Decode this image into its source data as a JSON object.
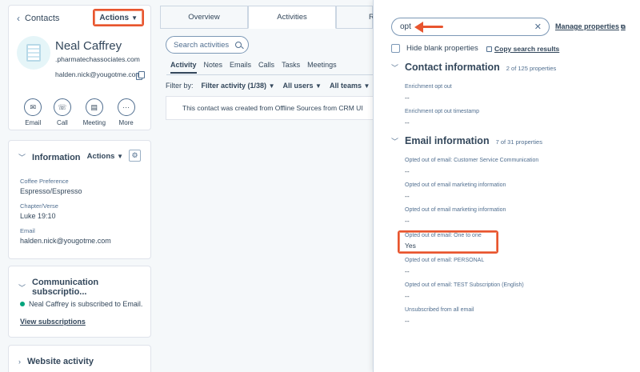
{
  "left": {
    "back_label": "Contacts",
    "actions_label": "Actions",
    "contact": {
      "name": "Neal Caffrey",
      "domain": ".pharmatechassociates.com",
      "email": "halden.nick@yougotme.com"
    },
    "quick_actions": [
      {
        "label": "Email",
        "icon": "envelope-icon",
        "glyph": "✉"
      },
      {
        "label": "Call",
        "icon": "phone-icon",
        "glyph": "☏"
      },
      {
        "label": "Meeting",
        "icon": "calendar-icon",
        "glyph": "▤"
      },
      {
        "label": "More",
        "icon": "more-icon",
        "glyph": "···"
      }
    ],
    "information": {
      "title": "Information",
      "actions_label": "Actions",
      "fields": [
        {
          "label": "Coffee Preference",
          "value": "Espresso/Espresso"
        },
        {
          "label": "Chapter/Verse",
          "value": "Luke 19:10"
        },
        {
          "label": "Email",
          "value": "halden.nick@yougotme.com"
        }
      ]
    },
    "communication": {
      "title": "Communication subscriptio...",
      "status": "Neal Caffrey is subscribed to Email.",
      "link": "View subscriptions"
    },
    "website": {
      "title": "Website activity"
    }
  },
  "middle": {
    "tabs": [
      "Overview",
      "Activities",
      "R"
    ],
    "search_placeholder": "Search activities",
    "subtabs": [
      "Activity",
      "Notes",
      "Emails",
      "Calls",
      "Tasks",
      "Meetings"
    ],
    "filter_label": "Filter by:",
    "filters": [
      "Filter activity (1/38)",
      "All users",
      "All teams"
    ],
    "note": "This contact was created from Offline Sources from CRM UI"
  },
  "panel": {
    "search_value": "opt",
    "manage_label": "Manage properties",
    "hide_blank_label": "Hide blank properties",
    "copy_results_label": "Copy search results",
    "groups": [
      {
        "title": "Contact information",
        "count": "2 of 125 properties",
        "props": [
          {
            "label": "Enrichment opt out",
            "value": "--"
          },
          {
            "label": "Enrichment opt out timestamp",
            "value": "--"
          }
        ]
      },
      {
        "title": "Email information",
        "count": "7 of 31 properties",
        "props": [
          {
            "label": "Opted out of email: Customer Service Communication",
            "value": "--"
          },
          {
            "label": "Opted out of email marketing information",
            "value": "--"
          },
          {
            "label": "Opted out of email marketing information",
            "value": "--"
          },
          {
            "label": "Opted out of email: One to one",
            "value": "Yes"
          },
          {
            "label": "Opted out of email: PERSONAL",
            "value": "--"
          },
          {
            "label": "Opted out of email: TEST Subscription (English)",
            "value": "--"
          },
          {
            "label": "Unsubscribed from all email",
            "value": "--"
          }
        ]
      }
    ]
  },
  "colors": {
    "accent": "#e8552f",
    "text": "#33475b",
    "subscribed": "#00a47c"
  }
}
